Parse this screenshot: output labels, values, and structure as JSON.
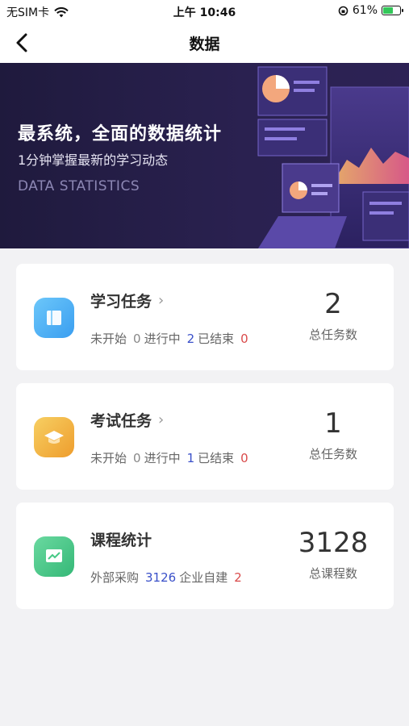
{
  "status_bar": {
    "carrier": "无SIM卡",
    "time": "上午 10:46",
    "battery": "61%",
    "battery_level": 0.61
  },
  "nav": {
    "title": "数据"
  },
  "banner": {
    "title": "最系统，全面的数据统计",
    "subtitle": "1分钟掌握最新的学习动态",
    "english": "DATA STATISTICS"
  },
  "cards": [
    {
      "title": "学习任务",
      "stat1_label": "未开始",
      "stat1_value": "0",
      "stat2_label": "进行中",
      "stat2_value": "2",
      "stat3_label": "已结束",
      "stat3_value": "0",
      "total_value": "2",
      "total_label": "总任务数",
      "icon_color": "#4ab0f0"
    },
    {
      "title": "考试任务",
      "stat1_label": "未开始",
      "stat1_value": "0",
      "stat2_label": "进行中",
      "stat2_value": "1",
      "stat3_label": "已结束",
      "stat3_value": "0",
      "total_value": "1",
      "total_label": "总任务数",
      "icon_color": "#f2b541"
    },
    {
      "title": "课程统计",
      "stat1_label": "外部采购",
      "stat1_value": "3126",
      "stat2_label": "企业自建",
      "stat2_value": "2",
      "total_value": "3128",
      "total_label": "总课程数",
      "icon_color": "#45c985"
    }
  ],
  "colors": {
    "accent_blue": "#3a50c9",
    "accent_red": "#d94a4a",
    "banner_bg": "#251d48"
  }
}
